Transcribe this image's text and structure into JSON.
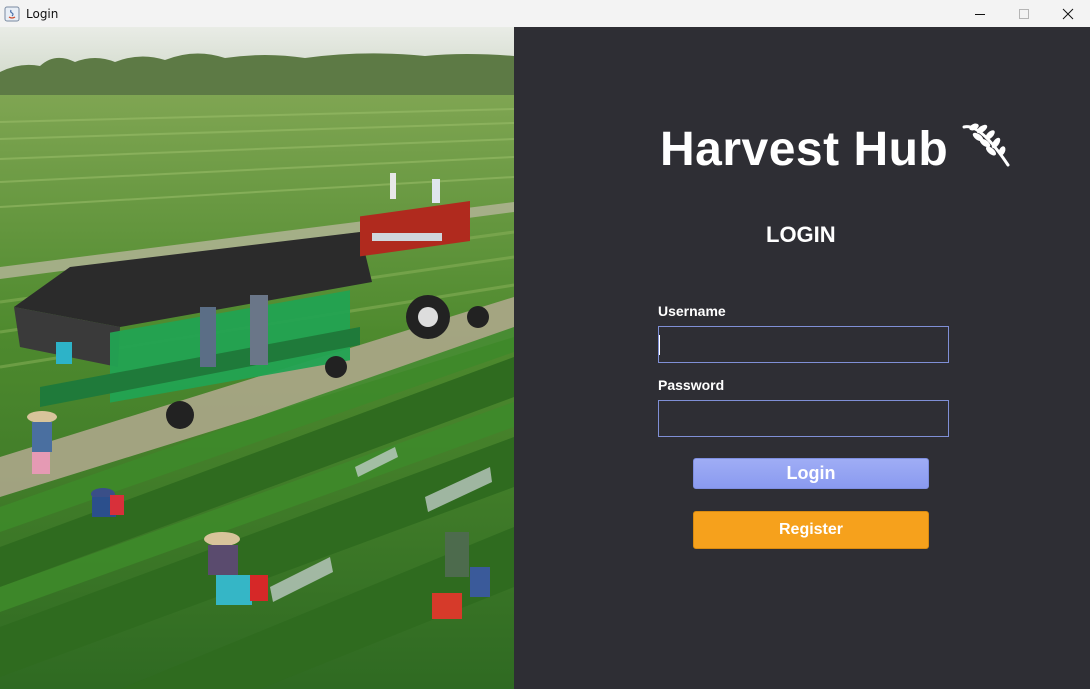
{
  "window": {
    "title": "Login",
    "controls": {
      "minimize": "—",
      "maximize": "☐",
      "close": "✕"
    }
  },
  "brand": {
    "title": "Harvest Hub",
    "icon": "wheat-icon"
  },
  "form": {
    "heading": "LOGIN",
    "username_label": "Username",
    "username_value": "",
    "password_label": "Password",
    "password_value": "",
    "login_button": "Login",
    "register_button": "Register"
  },
  "colors": {
    "panel_bg": "#2e2e34",
    "field_border": "#7f8fd6",
    "login_button": "#929ff2",
    "register_button": "#f6a11c"
  }
}
